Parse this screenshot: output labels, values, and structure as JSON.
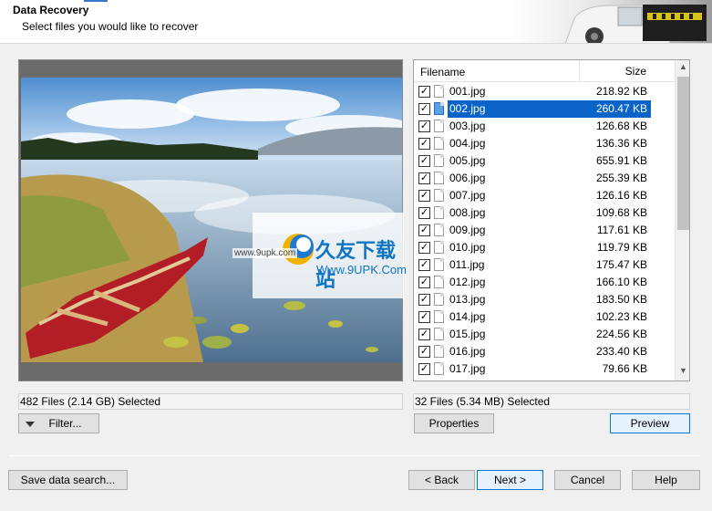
{
  "header": {
    "title": "Data Recovery",
    "subtitle": "Select files you would like to recover"
  },
  "list": {
    "col_filename": "Filename",
    "col_size": "Size",
    "rows": [
      {
        "name": "001.jpg",
        "size": "218.92 KB",
        "checked": true,
        "selected": false
      },
      {
        "name": "002.jpg",
        "size": "260.47 KB",
        "checked": true,
        "selected": true
      },
      {
        "name": "003.jpg",
        "size": "126.68 KB",
        "checked": true,
        "selected": false
      },
      {
        "name": "004.jpg",
        "size": "136.36 KB",
        "checked": true,
        "selected": false
      },
      {
        "name": "005.jpg",
        "size": "655.91 KB",
        "checked": true,
        "selected": false
      },
      {
        "name": "006.jpg",
        "size": "255.39 KB",
        "checked": true,
        "selected": false
      },
      {
        "name": "007.jpg",
        "size": "126.16 KB",
        "checked": true,
        "selected": false
      },
      {
        "name": "008.jpg",
        "size": "109.68 KB",
        "checked": true,
        "selected": false
      },
      {
        "name": "009.jpg",
        "size": "117.61 KB",
        "checked": true,
        "selected": false
      },
      {
        "name": "010.jpg",
        "size": "119.79 KB",
        "checked": true,
        "selected": false
      },
      {
        "name": "011.jpg",
        "size": "175.47 KB",
        "checked": true,
        "selected": false
      },
      {
        "name": "012.jpg",
        "size": "166.10 KB",
        "checked": true,
        "selected": false
      },
      {
        "name": "013.jpg",
        "size": "183.50 KB",
        "checked": true,
        "selected": false
      },
      {
        "name": "014.jpg",
        "size": "102.23 KB",
        "checked": true,
        "selected": false
      },
      {
        "name": "015.jpg",
        "size": "224.56 KB",
        "checked": true,
        "selected": false
      },
      {
        "name": "016.jpg",
        "size": "233.40 KB",
        "checked": true,
        "selected": false
      },
      {
        "name": "017.jpg",
        "size": "79.66 KB",
        "checked": true,
        "selected": false
      }
    ]
  },
  "status": {
    "left": "482 Files (2.14 GB) Selected",
    "right": "32 Files (5.34 MB) Selected"
  },
  "buttons": {
    "filter": "Filter...",
    "properties": "Properties",
    "preview": "Preview",
    "save_search": "Save data search...",
    "back": "< Back",
    "next": "Next >",
    "cancel": "Cancel",
    "help": "Help"
  },
  "watermark": {
    "brand": "久友下载站",
    "url": "Www.9UPK.Com",
    "side": "www.9upk.com"
  },
  "colors": {
    "selection": "#0a64c8",
    "accent_border": "#0078d7"
  }
}
